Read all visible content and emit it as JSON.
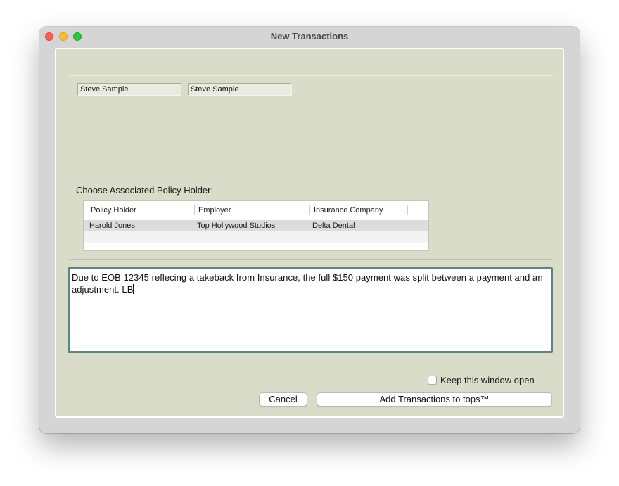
{
  "window": {
    "title": "New Transactions"
  },
  "fields": {
    "name_1": "Steve Sample",
    "name_2": "Steve Sample"
  },
  "policy": {
    "label": "Choose Associated Policy Holder:",
    "columns": [
      "Policy Holder",
      "Employer",
      "Insurance Company"
    ],
    "rows": [
      {
        "holder": "Harold Jones",
        "employer": "Top Hollywood Studios",
        "company": "Delta Dental"
      }
    ]
  },
  "notes": {
    "text": "Due to EOB 12345 reflecing a takeback from Insurance, the full $150 payment was split between a payment and an adjustment. LB"
  },
  "footer": {
    "keep_open_label": "Keep this window open",
    "keep_open_checked": false,
    "cancel_label": "Cancel",
    "add_label": "Add Transactions to tops™"
  }
}
